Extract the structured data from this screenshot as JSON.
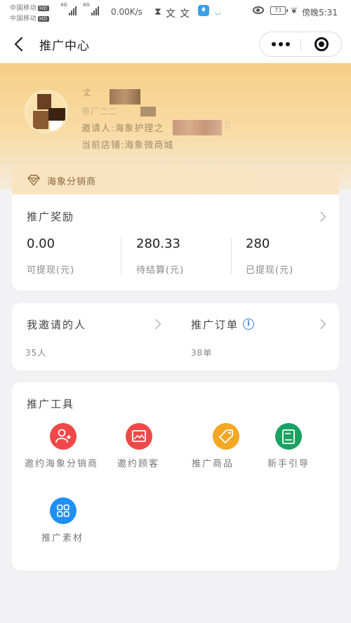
{
  "status_bar": {
    "carrier_1": "中国移动",
    "carrier_2": "中国移动",
    "hd_1": "HD",
    "hd_2": "HD",
    "net_1": "4G",
    "net_2": "4G",
    "net_3": "4G",
    "speed": "0.00K/s",
    "battery": "73",
    "time": "傍晚5:31"
  },
  "nav": {
    "title": "推广中心"
  },
  "profile": {
    "name": "丈",
    "phone": "帝厂二二",
    "inviter": "邀请人:海象护理之",
    "inviter_tail": "0",
    "store": "当前店铺:海象微商城"
  },
  "distributor": {
    "label": "海象分销商"
  },
  "reward": {
    "title": "推广奖励",
    "stats": [
      {
        "value": "0.00",
        "label": "可提现(元)"
      },
      {
        "value": "280.33",
        "label": "待结算(元)"
      },
      {
        "value": "280",
        "label": "已提现(元)"
      }
    ]
  },
  "invite": {
    "people_title": "我邀请的人",
    "people_count": "35人",
    "orders_title": "推广订单",
    "orders_count": "38单"
  },
  "tools": {
    "title": "推广工具",
    "items": [
      {
        "label": "邀约海象分销商",
        "icon": "add-user-icon",
        "color": "#f04848"
      },
      {
        "label": "邀约顾客",
        "icon": "image-icon",
        "color": "#f04848"
      },
      {
        "label": "推广商品",
        "icon": "tag-icon",
        "color": "#f5a623"
      },
      {
        "label": "新手引导",
        "icon": "book-icon",
        "color": "#1aa260"
      },
      {
        "label": "推广素材",
        "icon": "grid-icon",
        "color": "#1e90f5"
      }
    ]
  },
  "colors": {
    "hero_gold": "#f6cf86",
    "accent_blue": "#3a7bd5"
  }
}
